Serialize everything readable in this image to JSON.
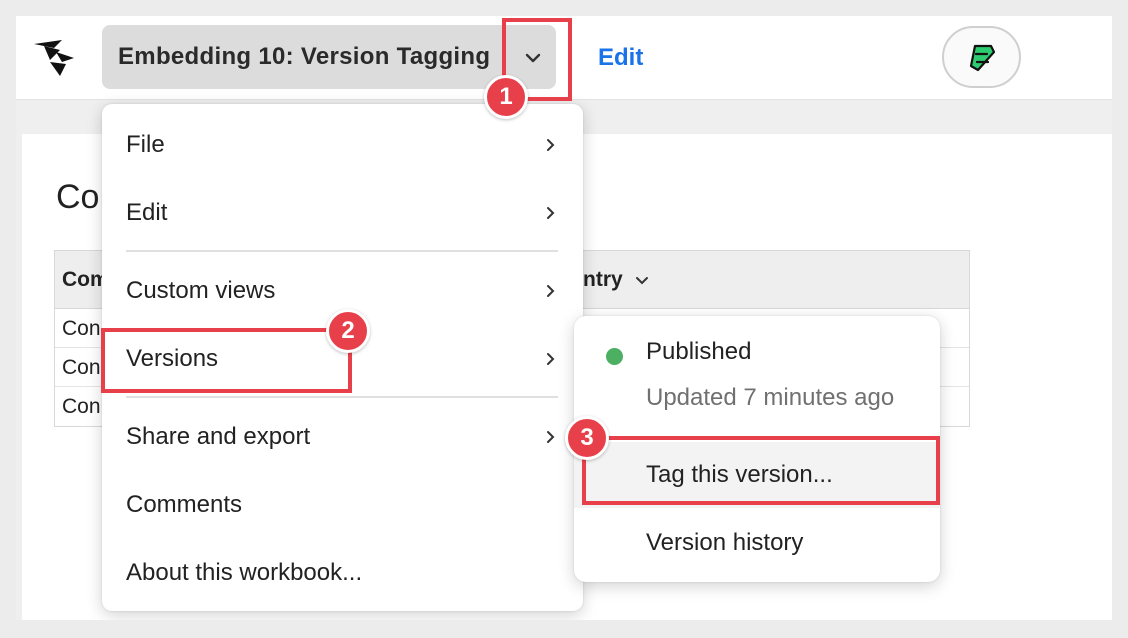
{
  "header": {
    "workbook_title": "Embedding 10: Version Tagging",
    "edit_label": "Edit"
  },
  "content": {
    "title": "Co",
    "columns": [
      "Com",
      "ntry"
    ],
    "rows": [
      "Con",
      "Con",
      "Con"
    ]
  },
  "menu": {
    "items": [
      {
        "label": "File",
        "has_submenu": true
      },
      {
        "label": "Edit",
        "has_submenu": true
      },
      {
        "label": "Custom views",
        "has_submenu": true
      },
      {
        "label": "Versions",
        "has_submenu": true
      },
      {
        "label": "Share and export",
        "has_submenu": true
      },
      {
        "label": "Comments",
        "has_submenu": false
      },
      {
        "label": "About this workbook...",
        "has_submenu": false
      }
    ]
  },
  "versions_submenu": {
    "status": "Published",
    "status_color": "#4caf62",
    "updated": "Updated 7 minutes ago",
    "items": [
      {
        "label": "Tag this version...",
        "highlighted": true
      },
      {
        "label": "Version history",
        "highlighted": false
      }
    ]
  },
  "callouts": [
    "1",
    "2",
    "3"
  ],
  "colors": {
    "accent": "#1a73e8",
    "callout": "#e8404b"
  }
}
